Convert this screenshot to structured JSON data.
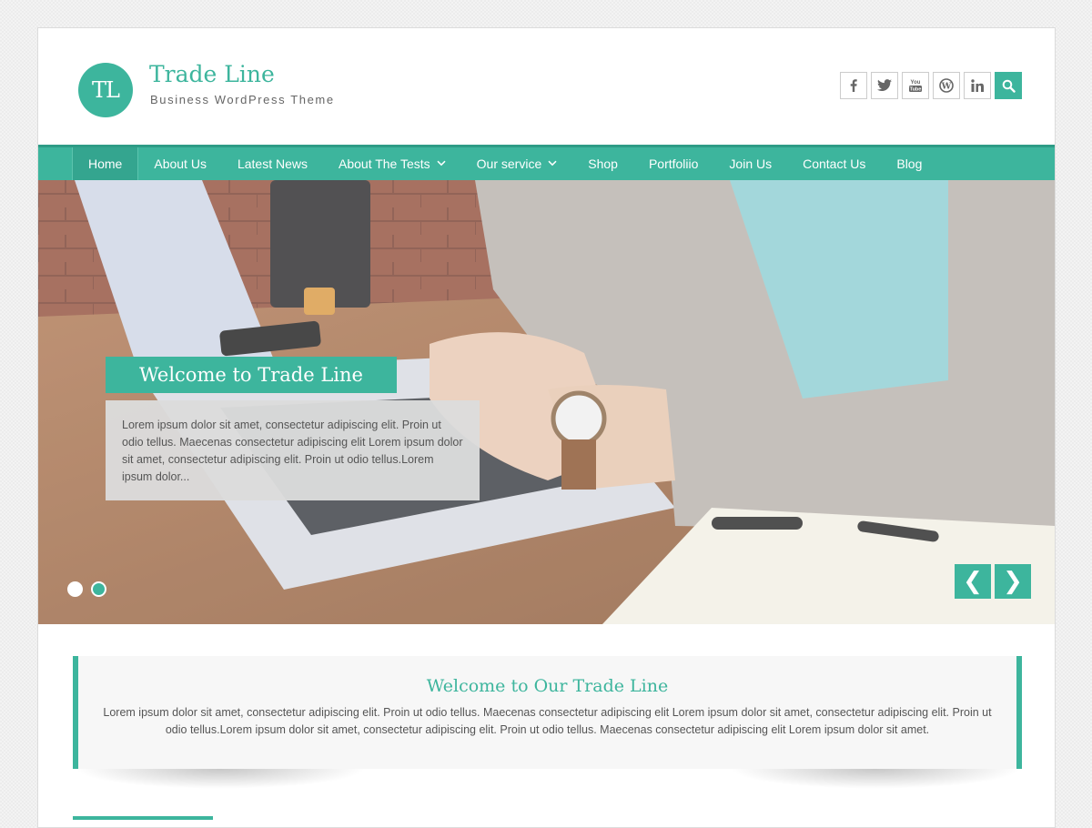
{
  "header": {
    "logo_text": "TL",
    "title": "Trade Line",
    "tagline": "Business WordPress Theme",
    "social": [
      {
        "icon": "facebook-icon",
        "glyph": "f"
      },
      {
        "icon": "twitter-icon",
        "glyph": "t"
      },
      {
        "icon": "youtube-icon",
        "glyph": "You"
      },
      {
        "icon": "wordpress-icon",
        "glyph": "W"
      },
      {
        "icon": "linkedin-icon",
        "glyph": "in"
      }
    ],
    "search_icon": "search-icon"
  },
  "nav": {
    "items": [
      {
        "label": "Home",
        "active": true,
        "has_dropdown": false
      },
      {
        "label": "About Us",
        "active": false,
        "has_dropdown": false
      },
      {
        "label": "Latest News",
        "active": false,
        "has_dropdown": false
      },
      {
        "label": "About The Tests",
        "active": false,
        "has_dropdown": true
      },
      {
        "label": "Our service",
        "active": false,
        "has_dropdown": true
      },
      {
        "label": "Shop",
        "active": false,
        "has_dropdown": false
      },
      {
        "label": "Portfoliio",
        "active": false,
        "has_dropdown": false
      },
      {
        "label": "Join Us",
        "active": false,
        "has_dropdown": false
      },
      {
        "label": "Contact Us",
        "active": false,
        "has_dropdown": false
      },
      {
        "label": "Blog",
        "active": false,
        "has_dropdown": false
      }
    ]
  },
  "slider": {
    "title": "Welcome to Trade Line",
    "text": "Lorem ipsum dolor sit amet, consectetur adipiscing elit. Proin ut odio tellus. Maecenas consectetur adipiscing elit Lorem ipsum dolor sit amet, consectetur adipiscing elit. Proin ut odio tellus.Lorem ipsum dolor...",
    "slide_count": 2,
    "current_slide": 1,
    "prev_glyph": "❮",
    "next_glyph": "❯"
  },
  "welcome": {
    "title": "Welcome to Our Trade Line",
    "text": "Lorem ipsum dolor sit amet, consectetur adipiscing elit. Proin ut odio tellus. Maecenas consectetur adipiscing elit Lorem ipsum dolor sit amet, consectetur adipiscing elit. Proin ut odio tellus.Lorem ipsum dolor sit amet, consectetur adipiscing elit. Proin ut odio tellus. Maecenas consectetur adipiscing elit Lorem ipsum dolor sit amet."
  },
  "colors": {
    "accent": "#3db59d",
    "accent_dark": "#2e9c86",
    "text": "#555555"
  }
}
